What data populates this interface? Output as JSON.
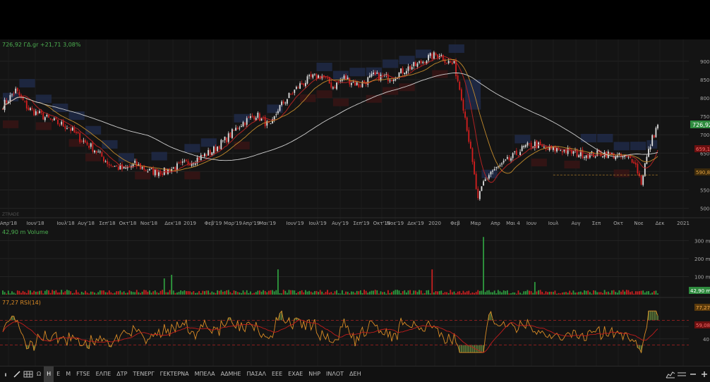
{
  "header": {
    "price_label": "726,92 ΓΔ.gr +21,71 3,08%",
    "watermark": "ZTRADE"
  },
  "volume_panel": {
    "label": "42,90 m Volume",
    "ticks": [
      "300 m",
      "200 m",
      "100 m"
    ],
    "last_tag": "42,90 m"
  },
  "rsi_panel": {
    "label": "77,27 RSI(14)",
    "ticks": [
      "60",
      "40"
    ],
    "rsi_tag": "77,27",
    "signal_tag": "59,08"
  },
  "price_panel": {
    "ticks": [
      "900",
      "850",
      "800",
      "750",
      "700",
      "650",
      "600",
      "550",
      "500"
    ],
    "last_tag": "726,92",
    "tag2": "659,1",
    "tag3": "590,8"
  },
  "colors": {
    "up": "#dedede",
    "down": "#d21f1f",
    "ma_short": "#c28a2c",
    "ma_mid": "#b02222",
    "ma_long": "#cfcfcf",
    "rsi": "#d98a25",
    "rsi_sig": "#c11c1c",
    "last": "#2e8b3e"
  },
  "chart_data": {
    "type": "candlestick",
    "title": "",
    "x_axis_labels": [
      "Απρ'18",
      "Ιουν'18",
      "Ιουλ'18",
      "Αυγ'18",
      "Σεπ'18",
      "Οκτ'18",
      "Νοε'18",
      "Δεκ'18",
      "2019",
      "Φεβ'19",
      "Μαρ'19",
      "Απρ'19",
      "Μαι'19",
      "Ιουν'19",
      "Ιουλ'19",
      "Αυγ'19",
      "Σεπ'19",
      "Οκτ'19",
      "Νοε'19",
      "Δεκ'19",
      "2020",
      "Φεβ",
      "Μαρ",
      "Απρ",
      "Μαι 4",
      "Ιουν",
      "Ιουλ",
      "Αυγ",
      "Σεπ",
      "Οκτ",
      "Νοε",
      "Δεκ",
      "2021"
    ],
    "ylim": [
      480,
      940
    ],
    "close_anchors": [
      [
        0,
        780
      ],
      [
        7,
        820
      ],
      [
        14,
        770
      ],
      [
        26,
        740
      ],
      [
        36,
        720
      ],
      [
        42,
        690
      ],
      [
        50,
        660
      ],
      [
        58,
        620
      ],
      [
        66,
        605
      ],
      [
        72,
        620
      ],
      [
        80,
        600
      ],
      [
        88,
        600
      ],
      [
        96,
        615
      ],
      [
        106,
        635
      ],
      [
        114,
        655
      ],
      [
        122,
        690
      ],
      [
        130,
        730
      ],
      [
        138,
        755
      ],
      [
        146,
        720
      ],
      [
        150,
        770
      ],
      [
        156,
        805
      ],
      [
        162,
        835
      ],
      [
        168,
        855
      ],
      [
        174,
        860
      ],
      [
        180,
        830
      ],
      [
        186,
        855
      ],
      [
        194,
        835
      ],
      [
        202,
        860
      ],
      [
        212,
        855
      ],
      [
        220,
        880
      ],
      [
        226,
        890
      ],
      [
        232,
        910
      ],
      [
        238,
        920
      ],
      [
        242,
        900
      ],
      [
        246,
        890
      ],
      [
        250,
        805
      ],
      [
        253,
        720
      ],
      [
        256,
        620
      ],
      [
        259,
        520
      ],
      [
        262,
        570
      ],
      [
        266,
        600
      ],
      [
        270,
        610
      ],
      [
        274,
        625
      ],
      [
        278,
        640
      ],
      [
        284,
        665
      ],
      [
        290,
        675
      ],
      [
        296,
        660
      ],
      [
        304,
        660
      ],
      [
        312,
        650
      ],
      [
        320,
        645
      ],
      [
        328,
        650
      ],
      [
        336,
        640
      ],
      [
        344,
        632
      ],
      [
        348,
        570
      ],
      [
        350,
        620
      ],
      [
        354,
        690
      ],
      [
        357,
        726.92
      ]
    ],
    "volume": {
      "ylim": [
        0,
        360
      ],
      "spikes": [
        [
          88,
          90
        ],
        [
          92,
          110
        ],
        [
          150,
          140
        ],
        [
          234,
          140
        ],
        [
          262,
          320
        ],
        [
          290,
          70
        ]
      ],
      "last": 42.9
    },
    "rsi": {
      "ylim": [
        0,
        100
      ],
      "levels": [
        70,
        30
      ],
      "last": 77.27,
      "signal_last": 59.08
    }
  }
}
